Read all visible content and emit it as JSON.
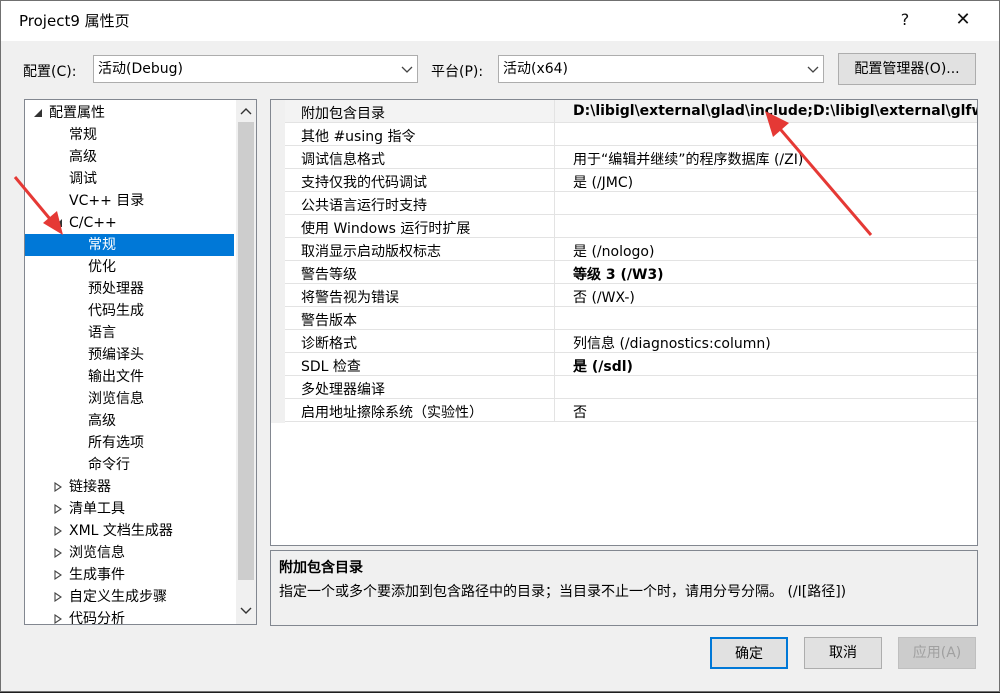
{
  "window": {
    "title": "Project9 属性页",
    "help_label": "?",
    "close_label": "✕"
  },
  "config": {
    "config_label": "配置(C):",
    "config_value": "活动(Debug)",
    "platform_label": "平台(P):",
    "platform_value": "活动(x64)",
    "manager_button": "配置管理器(O)..."
  },
  "tree": {
    "items": [
      {
        "label": "配置属性",
        "expanded": true
      },
      {
        "label": "常规"
      },
      {
        "label": "高级"
      },
      {
        "label": "调试"
      },
      {
        "label": "VC++ 目录"
      },
      {
        "label": "C/C++",
        "expanded": true
      },
      {
        "label": "常规",
        "selected": true
      },
      {
        "label": "优化"
      },
      {
        "label": "预处理器"
      },
      {
        "label": "代码生成"
      },
      {
        "label": "语言"
      },
      {
        "label": "预编译头"
      },
      {
        "label": "输出文件"
      },
      {
        "label": "浏览信息"
      },
      {
        "label": "高级"
      },
      {
        "label": "所有选项"
      },
      {
        "label": "命令行"
      },
      {
        "label": "链接器",
        "expanded": false
      },
      {
        "label": "清单工具",
        "expanded": false
      },
      {
        "label": "XML 文档生成器",
        "expanded": false
      },
      {
        "label": "浏览信息",
        "expanded": false
      },
      {
        "label": "生成事件",
        "expanded": false
      },
      {
        "label": "自定义生成步骤",
        "expanded": false
      },
      {
        "label": "代码分析",
        "expanded": false
      }
    ]
  },
  "properties": [
    {
      "name": "附加包含目录",
      "value": "D:\\libigl\\external\\glad\\include;D:\\libigl\\external\\glfw\\include",
      "bold": true
    },
    {
      "name": "其他 #using 指令",
      "value": ""
    },
    {
      "name": "调试信息格式",
      "value": "用于“编辑并继续”的程序数据库 (/ZI)"
    },
    {
      "name": "支持仅我的代码调试",
      "value": "是 (/JMC)"
    },
    {
      "name": "公共语言运行时支持",
      "value": ""
    },
    {
      "name": "使用 Windows 运行时扩展",
      "value": ""
    },
    {
      "name": "取消显示启动版权标志",
      "value": "是 (/nologo)"
    },
    {
      "name": "警告等级",
      "value": "等级 3 (/W3)",
      "bold": true
    },
    {
      "name": "将警告视为错误",
      "value": "否 (/WX-)"
    },
    {
      "name": "警告版本",
      "value": ""
    },
    {
      "name": "诊断格式",
      "value": "列信息 (/diagnostics:column)"
    },
    {
      "name": "SDL 检查",
      "value": "是 (/sdl)",
      "bold": true
    },
    {
      "name": "多处理器编译",
      "value": ""
    },
    {
      "name": "启用地址擦除系统（实验性）",
      "value": "否"
    }
  ],
  "description": {
    "title": "附加包含目录",
    "text": "指定一个或多个要添加到包含路径中的目录；当目录不止一个时，请用分号分隔。     (/I[路径])"
  },
  "buttons": {
    "ok": "确定",
    "cancel": "取消",
    "apply": "应用(A)"
  },
  "colors": {
    "selection": "#0078d7",
    "annotation_arrow": "#e53935"
  }
}
